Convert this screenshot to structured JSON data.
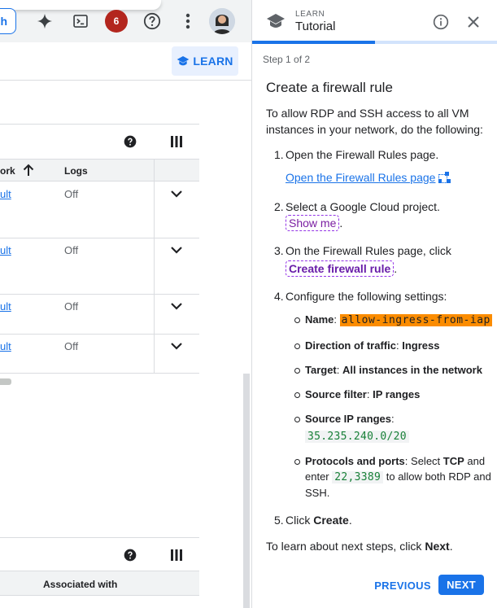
{
  "console": {
    "search_button_label": "h",
    "notification_count": "6",
    "learn_button_label": "LEARN",
    "table1": {
      "columns": [
        "ork",
        "Logs"
      ],
      "rows": [
        {
          "network": "ult",
          "logs": "Off"
        },
        {
          "network": "ult",
          "logs": "Off"
        },
        {
          "network": "ult",
          "logs": "Off"
        },
        {
          "network": "ult",
          "logs": "Off"
        }
      ]
    },
    "table2": {
      "columns": [
        "Associated with"
      ]
    }
  },
  "panel": {
    "eyebrow": "LEARN",
    "title": "Tutorial",
    "progress_fraction": 0.5,
    "step_label": "Step 1 of 2",
    "heading": "Create a firewall rule",
    "intro": "To allow RDP and SSH access to all VM instances in your network, do the following:",
    "steps": {
      "s1_text": "Open the Firewall Rules page.",
      "s1_link": "Open the Firewall Rules page",
      "s2_text": "Select a Google Cloud project.",
      "s2_button": "Show me",
      "s3_text": "On the Firewall Rules page, click",
      "s3_button": "Create firewall rule",
      "s4_text": "Configure the following settings:",
      "s5_prefix": "Click ",
      "s5_bold": "Create"
    },
    "settings": {
      "name_label": "Name",
      "name_value": "allow-ingress-from-iap",
      "direction_label": "Direction of traffic",
      "direction_value": "Ingress",
      "target_label": "Target",
      "target_value": "All instances in the network",
      "source_filter_label": "Source filter",
      "source_filter_value": "IP ranges",
      "source_ip_label": "Source IP ranges",
      "source_ip_value": "35.235.240.0/20",
      "protocols_label": "Protocols and ports",
      "protocols_text1": "Select ",
      "protocols_tcp": "TCP",
      "protocols_text2": " and enter ",
      "protocols_ports": "22,3389",
      "protocols_text3": " to allow both RDP and SSH."
    },
    "footer_prefix": "To learn about next steps, click ",
    "footer_bold": "Next",
    "previous_label": "PREVIOUS",
    "next_label": "NEXT"
  },
  "colors": {
    "accent": "#1a73e8",
    "highlight_orange": "#fb8c00",
    "code_green": "#188038",
    "dashed_purple": "#9334e6",
    "notification_red": "#b3261e"
  }
}
